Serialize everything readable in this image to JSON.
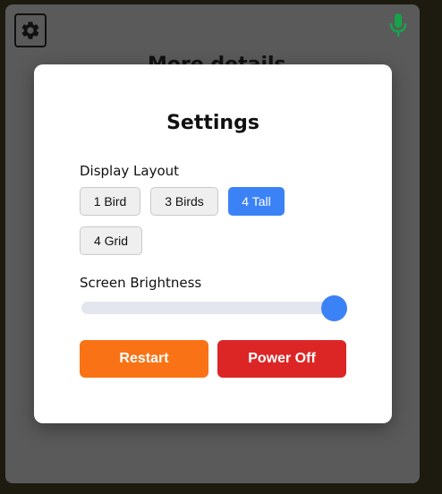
{
  "background": {
    "title": "More details"
  },
  "toolbar": {
    "settings_icon": "gear-icon",
    "mic_icon": "microphone-icon"
  },
  "settings": {
    "title": "Settings",
    "display_layout": {
      "label": "Display Layout",
      "options": [
        "1 Bird",
        "3 Birds",
        "4 Tall",
        "4 Grid"
      ],
      "selected": "4 Tall"
    },
    "brightness": {
      "label": "Screen Brightness",
      "value_fraction": 1.0
    },
    "actions": {
      "restart_label": "Restart",
      "power_off_label": "Power Off"
    }
  },
  "colors": {
    "accent": "#3b82f6",
    "restart": "#f97316",
    "power_off": "#dc2626",
    "mic": "#16a34a"
  }
}
